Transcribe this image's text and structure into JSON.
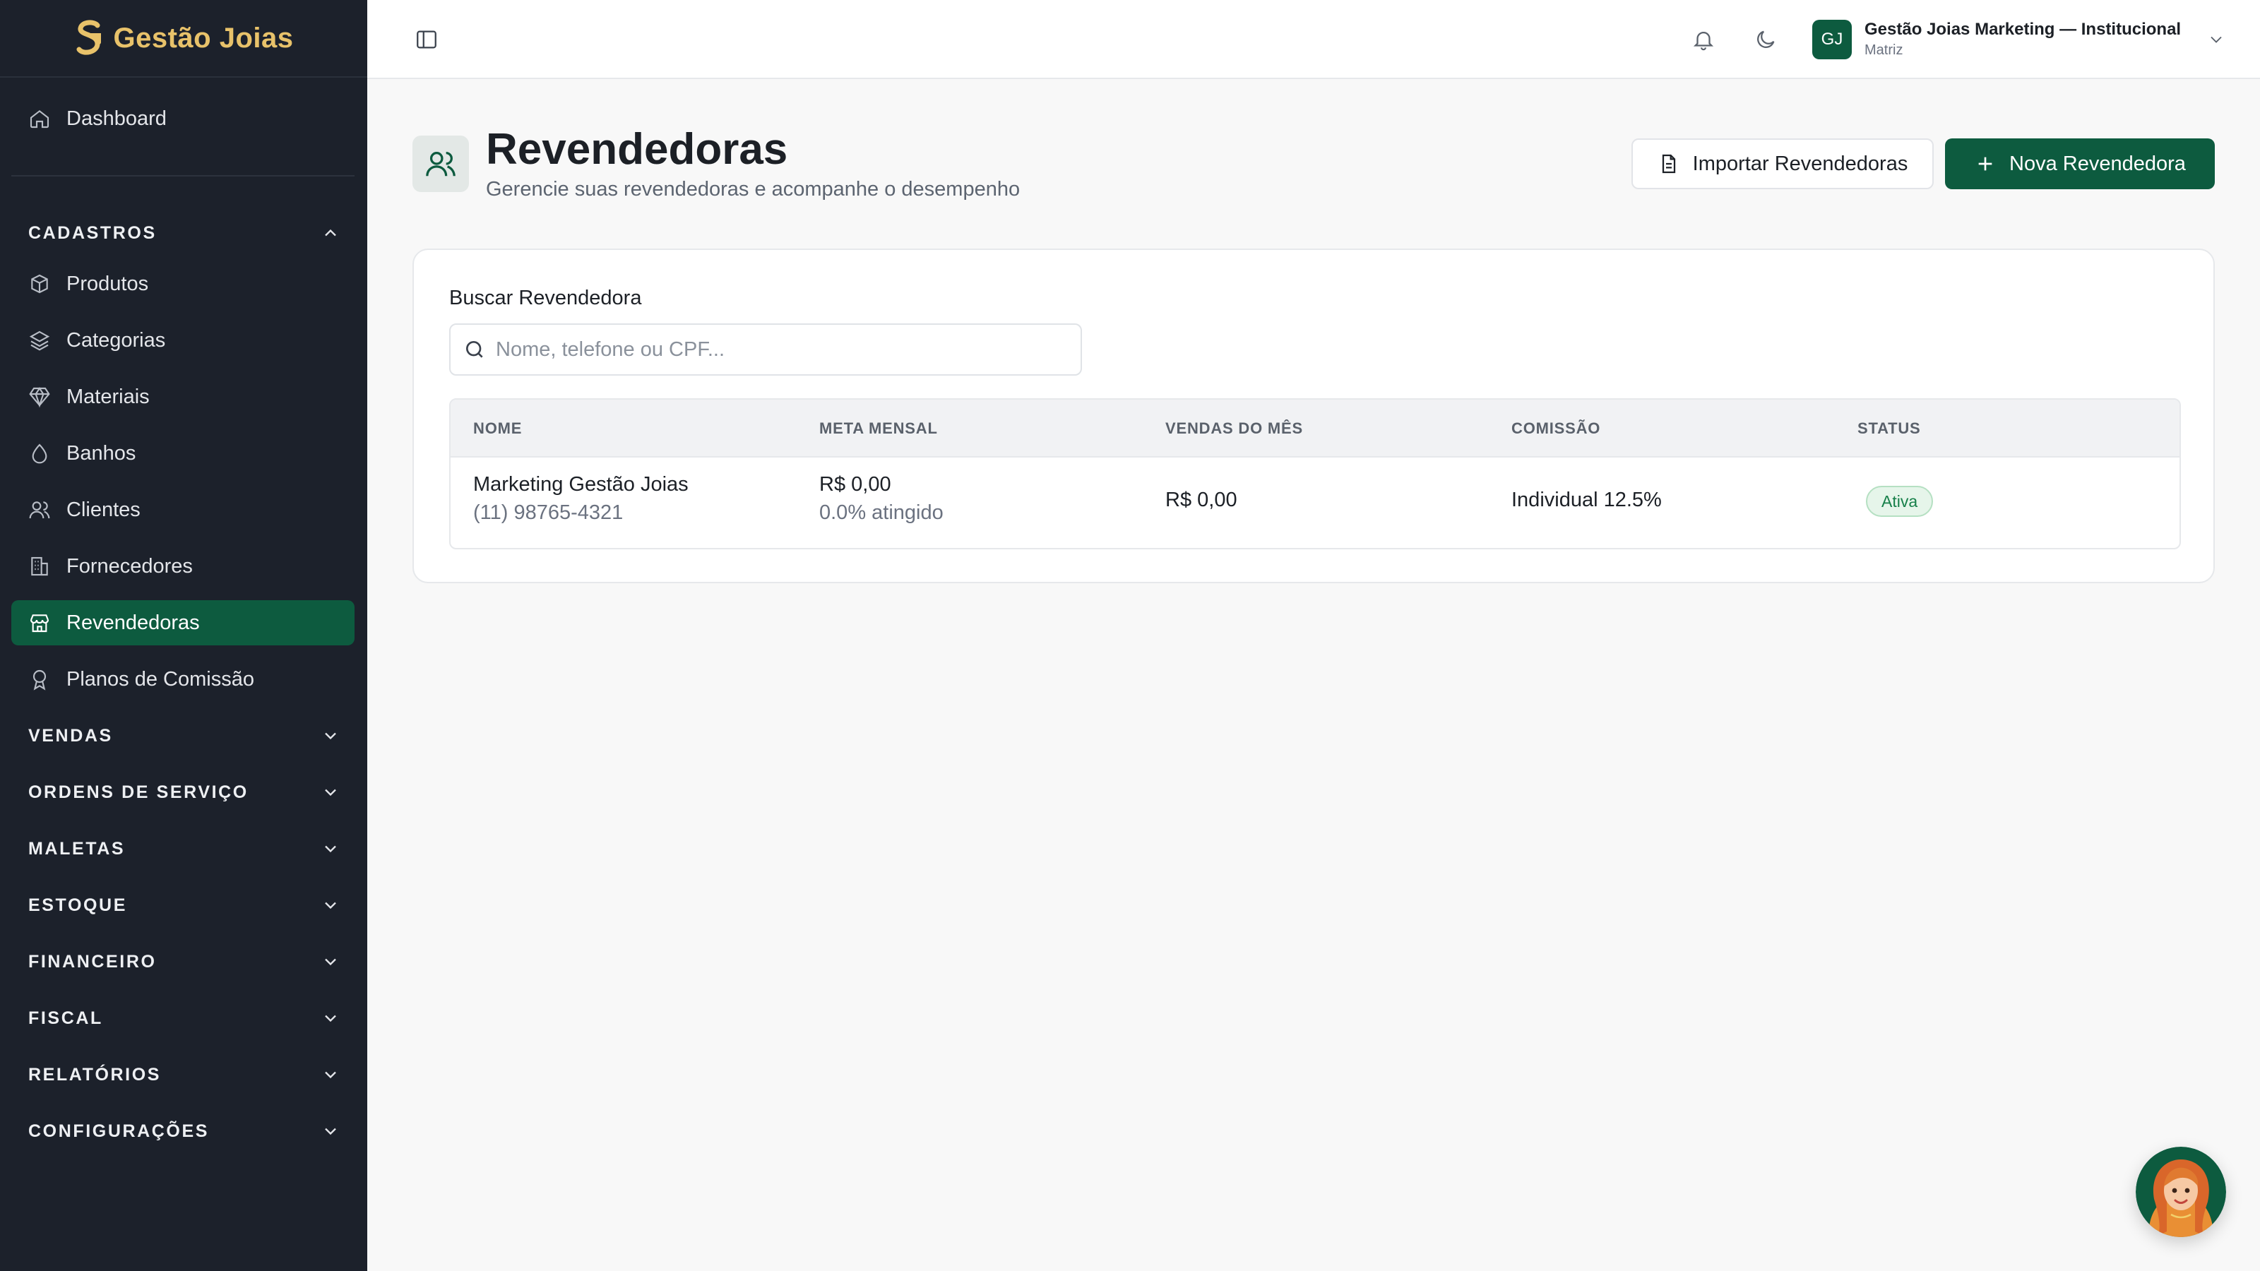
{
  "brand": {
    "name": "Gestão Joias",
    "accent": "#e8c26a"
  },
  "sidebar": {
    "dashboard": "Dashboard",
    "cadastros": {
      "title": "CADASTROS",
      "items": [
        "Produtos",
        "Categorias",
        "Materiais",
        "Banhos",
        "Clientes",
        "Fornecedores",
        "Revendedoras",
        "Planos de Comissão"
      ],
      "active": "Revendedoras"
    },
    "sections": [
      "VENDAS",
      "ORDENS DE SERVIÇO",
      "MALETAS",
      "ESTOQUE",
      "FINANCEIRO",
      "FISCAL",
      "RELATÓRIOS",
      "CONFIGURAÇÕES"
    ]
  },
  "topbar": {
    "avatar_initials": "GJ",
    "org_name": "Gestão Joias Marketing — Institucional",
    "org_sub": "Matriz"
  },
  "page": {
    "title": "Revendedoras",
    "subtitle": "Gerencie suas revendedoras e acompanhe o desempenho",
    "import_label": "Importar Revendedoras",
    "new_label": "Nova Revendedora"
  },
  "search": {
    "label": "Buscar Revendedora",
    "placeholder": "Nome, telefone ou CPF..."
  },
  "table": {
    "headers": [
      "NOME",
      "META MENSAL",
      "VENDAS DO MÊS",
      "COMISSÃO",
      "STATUS"
    ],
    "rows": [
      {
        "name": "Marketing Gestão Joias",
        "phone": "(11) 98765-4321",
        "meta": "R$ 0,00",
        "meta_pct": "0.0% atingido",
        "vendas": "R$ 0,00",
        "comissao": "Individual 12.5%",
        "status": "Ativa"
      }
    ]
  },
  "colors": {
    "primary": "#0d5b3f",
    "sidebar_bg": "#1c212b",
    "status_active": "#17804a"
  }
}
